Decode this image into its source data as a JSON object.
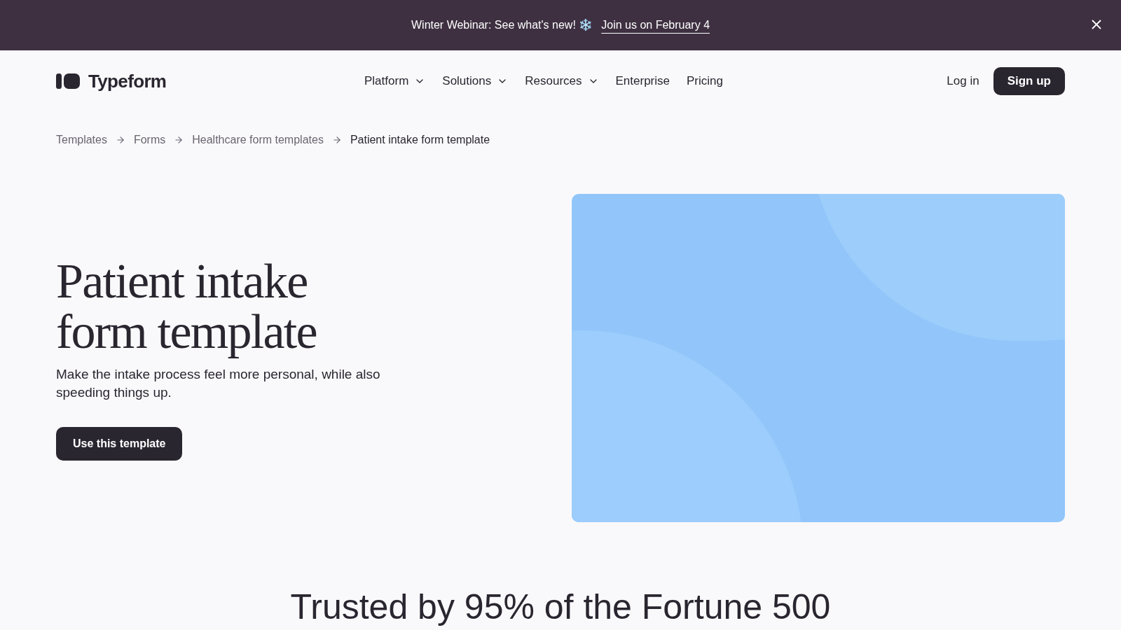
{
  "banner": {
    "text": "Winter Webinar: See what's new! ❄️",
    "link": "Join us on February 4"
  },
  "nav": {
    "brand": "Typeform",
    "items": [
      {
        "label": "Platform",
        "kind": "dropdown"
      },
      {
        "label": "Solutions",
        "kind": "dropdown"
      },
      {
        "label": "Resources",
        "kind": "dropdown"
      },
      {
        "label": "Enterprise",
        "kind": "link"
      },
      {
        "label": "Pricing",
        "kind": "link"
      }
    ],
    "login": "Log in",
    "signup": "Sign up"
  },
  "breadcrumbs": [
    {
      "label": "Templates",
      "current": false
    },
    {
      "label": "Forms",
      "current": false
    },
    {
      "label": "Healthcare form templates",
      "current": false
    },
    {
      "label": "Patient intake form template",
      "current": true
    }
  ],
  "hero": {
    "title_lines": [
      "Patient intake",
      "form template"
    ],
    "subtitle": "Make the intake process feel more personal, while also speeding things up.",
    "button": "Use this template"
  },
  "trusted": "Trusted by 95% of the Fortune 500"
}
